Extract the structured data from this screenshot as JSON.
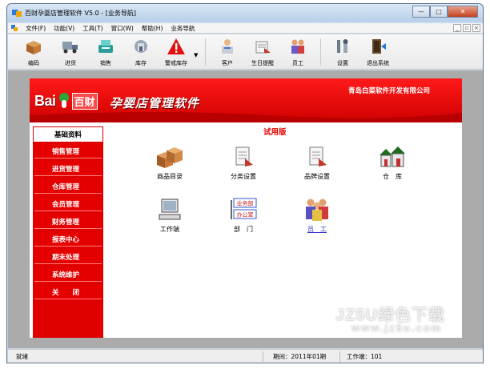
{
  "window": {
    "title": "百财孕婴店管理软件 V5.0 - [业务导航]",
    "buttons": [
      "—",
      "□",
      "✕"
    ]
  },
  "menubar": {
    "items": [
      "文件(F)",
      "功能(V)",
      "工具(T)",
      "窗口(W)",
      "帮助(H)",
      "业务导航"
    ],
    "mdi_buttons": [
      "_",
      "▫",
      "×"
    ]
  },
  "toolbar": {
    "items": [
      {
        "label": "编码",
        "icon": "package-box-icon"
      },
      {
        "label": "进货",
        "icon": "truck-icon"
      },
      {
        "label": "销售",
        "icon": "cash-register-icon"
      },
      {
        "label": "库存",
        "icon": "warehouse-icon"
      },
      {
        "label": "警戒库存",
        "icon": "warning-triangle-icon"
      },
      {
        "label": "客户",
        "icon": "customer-icon"
      },
      {
        "label": "生日提醒",
        "icon": "birthday-reminder-icon"
      },
      {
        "label": "员工",
        "icon": "staff-icon"
      },
      {
        "label": "设置",
        "icon": "settings-tools-icon"
      },
      {
        "label": "退出系统",
        "icon": "exit-door-icon"
      }
    ]
  },
  "banner": {
    "logo_text": "Bai",
    "logo_cn": "百财",
    "title": "孕婴店管理软件",
    "company": "青岛白菜软件开发有限公司"
  },
  "sidebar": {
    "header": "基础资料",
    "items": [
      "销售管理",
      "进货管理",
      "仓库管理",
      "会员管理",
      "财务管理",
      "报表中心",
      "期末处理",
      "系统维护",
      "关　　闭"
    ]
  },
  "main": {
    "trial_label": "试用版",
    "items": [
      {
        "label": "商品目录",
        "icon": "product-boxes-icon"
      },
      {
        "label": "分类设置",
        "icon": "category-settings-icon"
      },
      {
        "label": "品牌设置",
        "icon": "brand-settings-icon"
      },
      {
        "label": "仓　库",
        "icon": "warehouse-house-icon"
      },
      {
        "label": "工作端",
        "icon": "workstation-computer-icon"
      },
      {
        "label": "部　门",
        "icon": "department-icon",
        "sub_labels": [
          "业务部",
          "办公室"
        ]
      },
      {
        "label": "员　工",
        "icon": "employees-icon"
      }
    ]
  },
  "statusbar": {
    "status": "就绪",
    "period": "期间：2011年01期",
    "workstation": "工作端：101"
  },
  "watermark": {
    "text": "JZ5U绿色下载",
    "url": "www.jz5u.com"
  }
}
